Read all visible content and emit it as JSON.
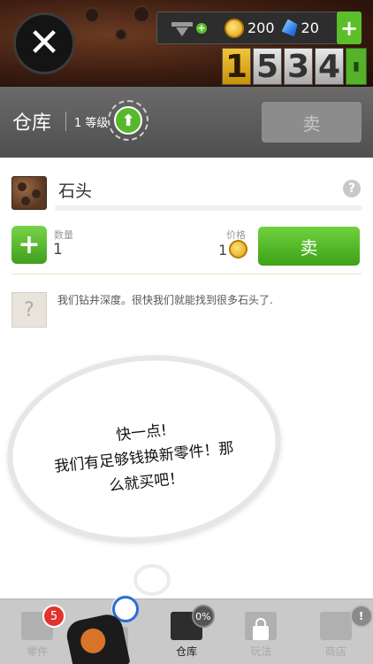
{
  "top": {
    "coins": "200",
    "gems": "20",
    "counter_digits": [
      "1",
      "5",
      "3",
      "4"
    ]
  },
  "warehouse": {
    "title": "仓库",
    "level_text": "1 等级",
    "sell_disabled_label": "卖"
  },
  "item": {
    "name": "石头",
    "quantity_label": "数量",
    "quantity": "1",
    "price_label": "价格",
    "price": "1",
    "sell_label": "卖",
    "hint_symbol": "?",
    "description": "我们钻井深度。很快我们就能找到很多石头了."
  },
  "bubble": {
    "lines": [
      "快一点!",
      "我们有足够钱换新零件！那",
      "么就买吧！"
    ]
  },
  "tabs": [
    {
      "label": "零件",
      "badge": "5"
    },
    {
      "label": "",
      "badge": ""
    },
    {
      "label": "仓库",
      "badge": "0%"
    },
    {
      "label": "玩法",
      "badge": ""
    },
    {
      "label": "商店",
      "badge": "!"
    }
  ],
  "colors": {
    "accent_green": "#5cbf2a",
    "header_grey": "#5a5a5a",
    "coin_gold": "#e3a10f"
  }
}
